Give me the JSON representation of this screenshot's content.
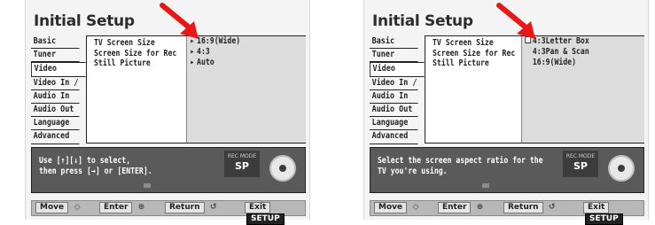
{
  "screens": [
    {
      "title": "Initial Setup",
      "tabs": [
        "Basic",
        "Tuner",
        "Video",
        "Video In / Out",
        "Audio In",
        "Audio Out",
        "Language",
        "Advanced"
      ],
      "active_tab": "Video",
      "settings": [
        "TV Screen Size",
        "Screen Size for Rec",
        "Still Picture"
      ],
      "options": [
        "16:9(Wide)",
        "4:3",
        "Auto"
      ],
      "option_marker": "arrow",
      "message": "Use [↑][↓] to select,\nthen press [→] or [ENTER].",
      "rec_mode_label": "REC MODE",
      "rec_mode_value": "SP",
      "nav": {
        "move": "Move",
        "enter": "Enter",
        "return": "Return",
        "exit": "Exit",
        "setup": "SETUP"
      }
    },
    {
      "title": "Initial Setup",
      "tabs": [
        "Basic",
        "Tuner",
        "Video",
        "Video In / Out",
        "Audio In",
        "Audio Out",
        "Language",
        "Advanced"
      ],
      "active_tab": "Video",
      "settings": [
        "TV Screen Size",
        "Screen Size for Rec",
        "Still Picture"
      ],
      "options": [
        "4:3Letter Box",
        "4:3Pan & Scan",
        "16:9(Wide)"
      ],
      "option_marker": "checkbox",
      "message": "Select the screen aspect ratio for the\nTV you're using.",
      "rec_mode_label": "REC MODE",
      "rec_mode_value": "SP",
      "nav": {
        "move": "Move",
        "enter": "Enter",
        "return": "Return",
        "exit": "Exit",
        "setup": "SETUP"
      }
    }
  ],
  "colors": {
    "arrow": "#e81818",
    "message_bg": "#5a5a5a",
    "options_bg": "#dcdcdc"
  },
  "icons": [
    "red-pointer-arrow",
    "option-triangle-icon",
    "option-checkbox-icon",
    "disc-icon",
    "dpad-icon",
    "enter-dial-icon",
    "return-icon"
  ]
}
